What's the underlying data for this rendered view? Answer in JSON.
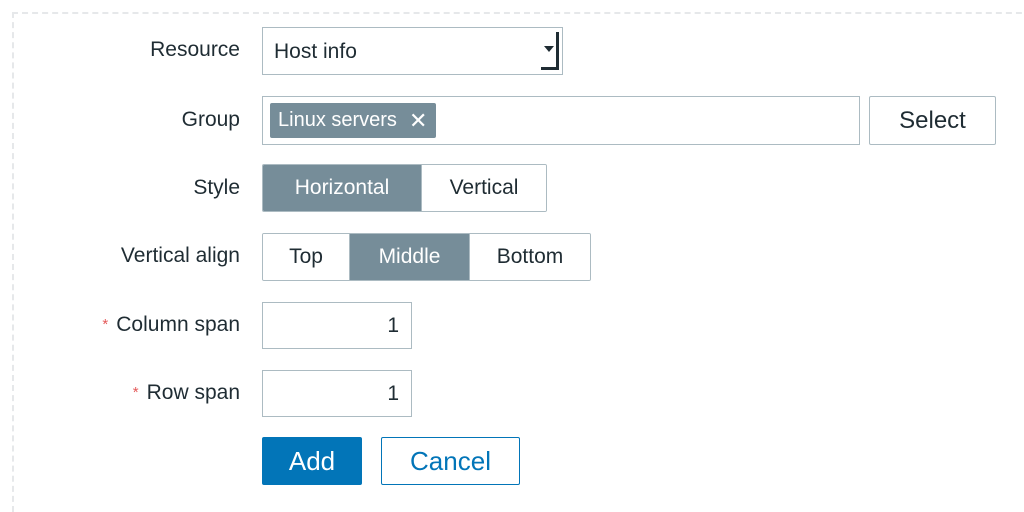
{
  "form": {
    "resource": {
      "label": "Resource",
      "value": "Host info"
    },
    "group": {
      "label": "Group",
      "tags": [
        "Linux servers"
      ],
      "select_label": "Select"
    },
    "style": {
      "label": "Style",
      "options": [
        "Horizontal",
        "Vertical"
      ],
      "selected": "Horizontal"
    },
    "valign": {
      "label": "Vertical align",
      "options": [
        "Top",
        "Middle",
        "Bottom"
      ],
      "selected": "Middle"
    },
    "column_span": {
      "label": "Column span",
      "required_mark": "*",
      "value": "1"
    },
    "row_span": {
      "label": "Row span",
      "required_mark": "*",
      "value": "1"
    }
  },
  "actions": {
    "add_label": "Add",
    "cancel_label": "Cancel"
  },
  "colors": {
    "primary": "#0275b8",
    "selected_segment": "#768d99",
    "required": "#e45959",
    "border": "#acbbc2"
  },
  "icons": {
    "dropdown": "chevron-down-icon",
    "remove_tag": "close-icon"
  }
}
